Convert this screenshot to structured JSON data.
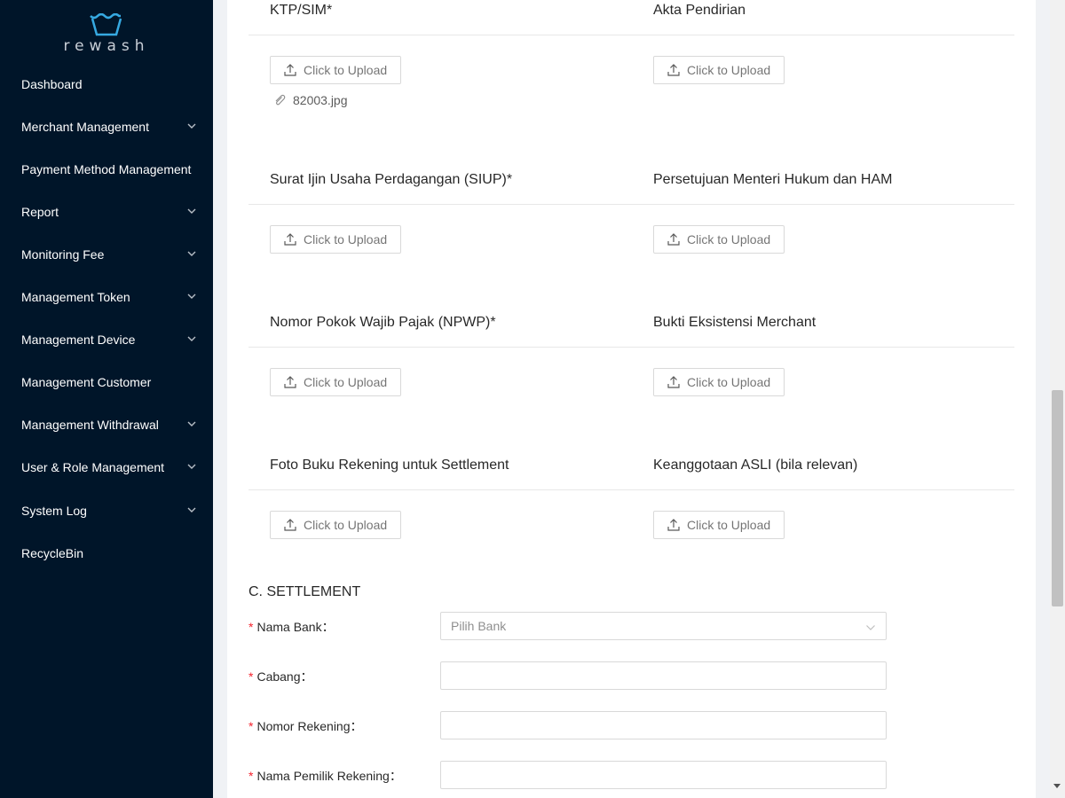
{
  "app": {
    "logo_text": "rewash"
  },
  "sidebar": {
    "items": [
      {
        "label": "Dashboard",
        "has_submenu": false
      },
      {
        "label": "Merchant Management",
        "has_submenu": true
      },
      {
        "label": "Payment Method Management",
        "has_submenu": false
      },
      {
        "label": "Report",
        "has_submenu": true
      },
      {
        "label": "Monitoring Fee",
        "has_submenu": true
      },
      {
        "label": "Management Token",
        "has_submenu": true
      },
      {
        "label": "Management Device",
        "has_submenu": true
      },
      {
        "label": "Management Customer",
        "has_submenu": false
      },
      {
        "label": "Management Withdrawal",
        "has_submenu": true
      },
      {
        "label": "User & Role Management",
        "has_submenu": true
      },
      {
        "label": "System Log",
        "has_submenu": true
      },
      {
        "label": "RecycleBin",
        "has_submenu": false
      }
    ]
  },
  "documents": {
    "upload_label": "Click to Upload",
    "items": [
      {
        "title": "KTP/SIM*",
        "file": "82003.jpg"
      },
      {
        "title": "Akta Pendirian"
      },
      {
        "title": "Surat Ijin Usaha Perdagangan (SIUP)*"
      },
      {
        "title": "Persetujuan Menteri Hukum dan HAM"
      },
      {
        "title": "Nomor Pokok Wajib Pajak (NPWP)*"
      },
      {
        "title": "Bukti Eksistensi Merchant"
      },
      {
        "title": "Foto Buku Rekening untuk Settlement"
      },
      {
        "title": "Keanggotaan ASLI (bila relevan)"
      }
    ]
  },
  "settlement": {
    "title": "C. SETTLEMENT",
    "required_mark": "*",
    "fields": {
      "bank": {
        "label": "Nama Bank",
        "placeholder": "Pilih Bank",
        "value": ""
      },
      "branch": {
        "label": "Cabang",
        "value": ""
      },
      "account_number": {
        "label": "Nomor Rekening",
        "value": ""
      },
      "account_holder": {
        "label": "Nama Pemilik Rekening",
        "value": ""
      }
    },
    "label_suffix": "："
  },
  "colors": {
    "sidebar_bg": "#001529",
    "logo_accent": "#36a9e1",
    "required": "#f5222d"
  }
}
